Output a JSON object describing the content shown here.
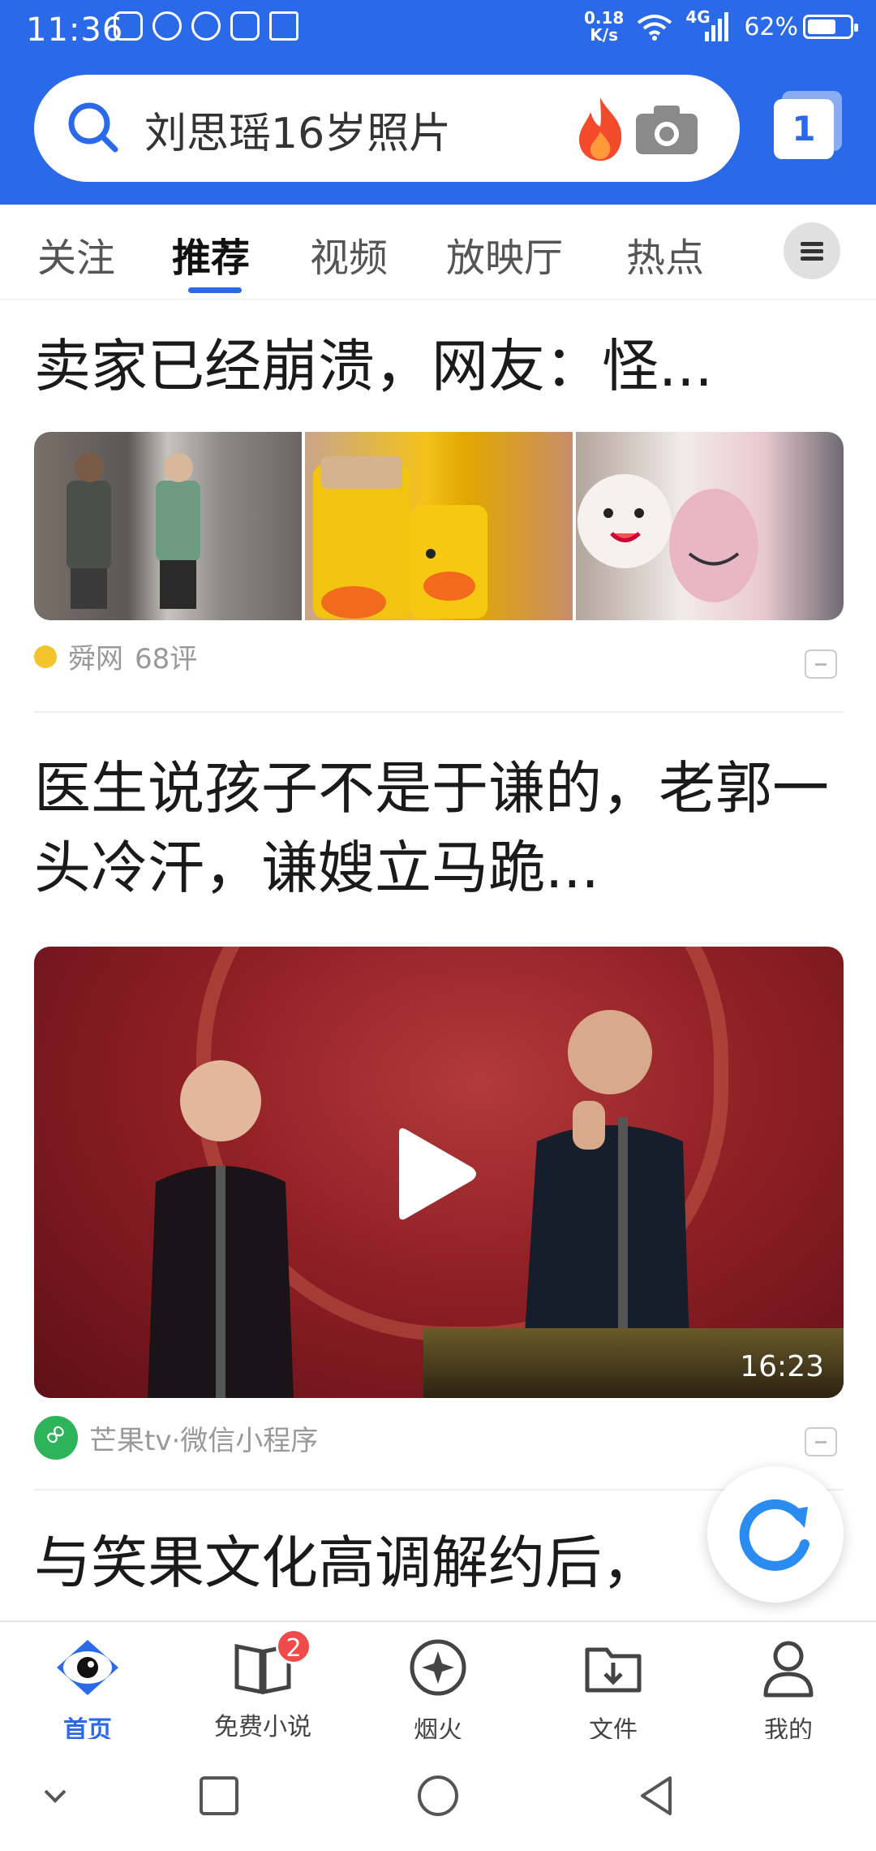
{
  "status_bar": {
    "time": "11:36",
    "net_speed_value": "0.18",
    "net_speed_unit": "K/s",
    "network": "4G",
    "battery": "62%"
  },
  "search": {
    "query": "刘思瑶16岁照片",
    "tab_count": "1"
  },
  "channels": {
    "tabs": [
      "关注",
      "推荐",
      "视频",
      "放映厅",
      "热点"
    ],
    "active": "推荐"
  },
  "feed": {
    "item1": {
      "title_tail": "卖家已经崩溃，网友：怪...",
      "source": "舜网",
      "comments": "68评"
    },
    "item2": {
      "title": "医生说孩子不是于谦的，老郭一头冷汗，谦嫂立马跪...",
      "duration": "16:23",
      "source": "芒果tv·微信小程序"
    },
    "item3": {
      "title": "与笑果文化高调解约后，"
    }
  },
  "bottom_nav": {
    "items": [
      {
        "label": "首页",
        "icon": "eye-icon"
      },
      {
        "label": "免费小说",
        "icon": "book-icon",
        "badge": "2"
      },
      {
        "label": "烟火",
        "icon": "sparkle-icon"
      },
      {
        "label": "文件",
        "icon": "folder-download-icon"
      },
      {
        "label": "我的",
        "icon": "person-icon"
      }
    ]
  },
  "colors": {
    "brand_blue": "#2a6ae8",
    "badge_red": "#ef4b4b"
  }
}
